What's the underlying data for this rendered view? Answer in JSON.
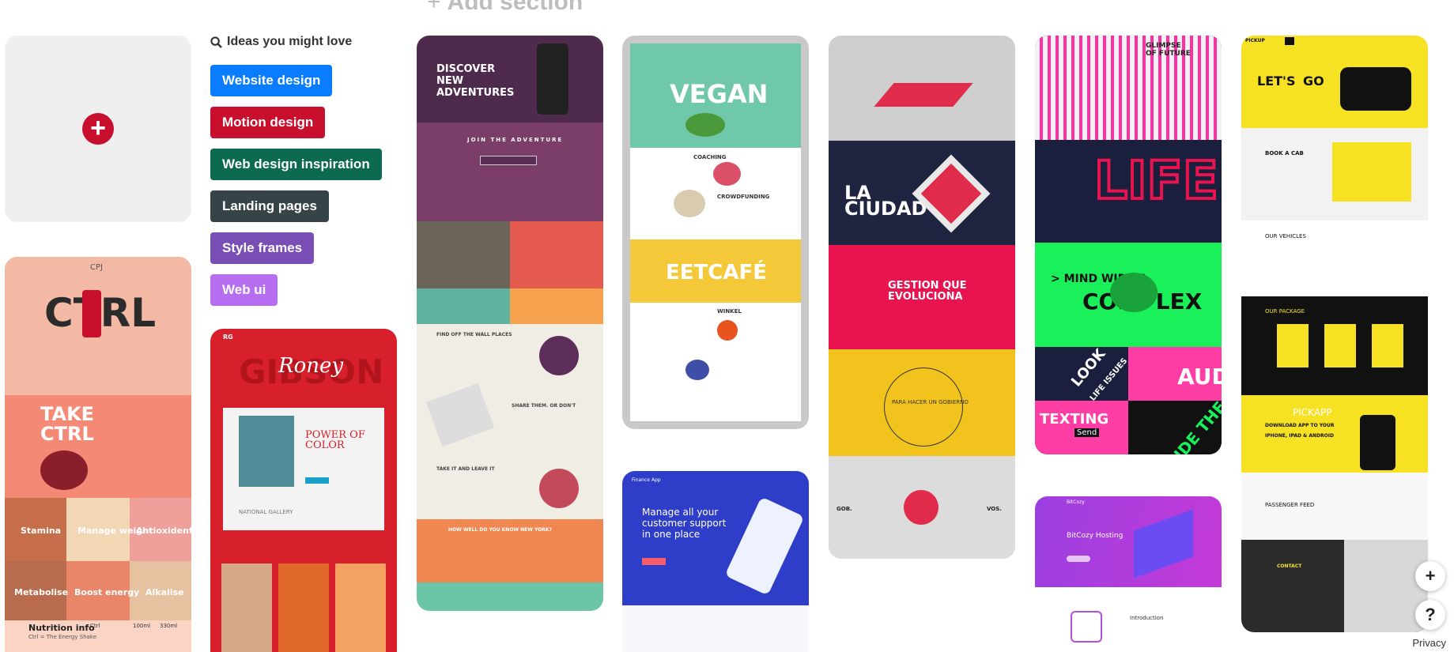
{
  "board": {
    "add_section_label": "Add section",
    "ideas_heading": "Ideas you might love",
    "chips": [
      {
        "label": "Website design",
        "color": "#0a7cff"
      },
      {
        "label": "Motion design",
        "color": "#c8102e"
      },
      {
        "label": "Web design inspiration",
        "color": "#0b6a4f"
      },
      {
        "label": "Landing pages",
        "color": "#364448"
      },
      {
        "label": "Style frames",
        "color": "#7a4fb5"
      },
      {
        "label": "Web ui",
        "color": "#b86ef0"
      }
    ]
  },
  "pins": {
    "ctrl": {
      "brand": "CPJ",
      "title": "CTRL",
      "take": "TAKE",
      "take2": "CTRL",
      "tiles": [
        "Stamina",
        "Manage weight",
        "Antioxident",
        "Metabolise",
        "Boost energy",
        "Alkalise"
      ],
      "nutrition": "Nutrition info",
      "nutrition_sub": "Ctrl = The Energy Shake",
      "col1": "Ctrl",
      "col2": "100ml",
      "col3": "330ml"
    },
    "gibson": {
      "logo": "RG",
      "title": "GIBSON",
      "script": "Roney",
      "headline": "POWER OF COLOR",
      "gallery": "NATIONAL GALLERY"
    },
    "adventure": {
      "title": "DISCOVER NEW ADVENTURES",
      "join": "JOIN THE ADVENTURE",
      "sec1": "FIND OFF THE WALL PLACES",
      "sec2": "SHARE THEM. OR DON'T",
      "sec3": "TAKE IT AND LEAVE IT",
      "sec4": "HOW WELL DO YOU KNOW NEW YORK?"
    },
    "vegan": {
      "title": "VEGAN",
      "coaching": "COACHING",
      "crowd": "CROWDFUNDING",
      "cafe": "EETCAFÉ",
      "winkel": "WINKEL"
    },
    "support": {
      "brand": "Finance App",
      "headline": "Manage all your customer support in one place"
    },
    "ciudad": {
      "title1": "LA",
      "title2": "CIUDAD",
      "gestion": "GESTION QUE EVOLUCIONA",
      "hacer": "PARA HACER UN GOBIERNO",
      "gob": "GOB.",
      "vos": "VOS."
    },
    "future": {
      "title": "GLIMPSE OF FUTURE",
      "life": "LIFE",
      "mind": "> MIND WIDE &",
      "complex": "COMPLEX",
      "look": "LOOK",
      "issues": "LIFE ISSUES",
      "aud": "AUD",
      "texting": "TEXTING",
      "send": "Send",
      "guide": "GUIDE THE EVO"
    },
    "bitcozy": {
      "brand": "BitCozy",
      "title": "BitCozy Hosting",
      "intro": "Introduction"
    },
    "pickup": {
      "brand": "PICKUP",
      "lets": "LET'S",
      "go": "GO",
      "book": "BOOK A CAB",
      "vehicles": "OUR VEHICLES",
      "package": "OUR PACKAGE",
      "app": "PICKAPP",
      "download": "DOWNLOAD APP TO YOUR",
      "devices": "IPHONE, IPAD & ANDROID",
      "feed": "PASSENGER FEED",
      "contact": "CONTACT"
    }
  },
  "controls": {
    "zoom_in": "+",
    "help": "?",
    "privacy": "Privacy"
  }
}
